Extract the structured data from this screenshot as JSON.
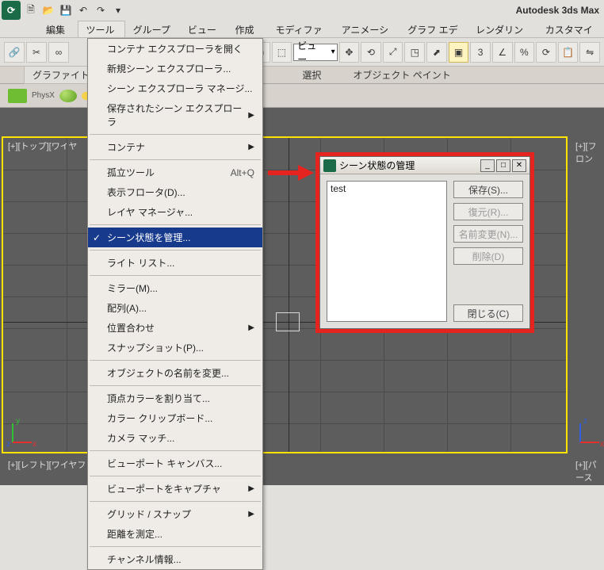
{
  "app": {
    "title": "Autodesk 3ds Max"
  },
  "menubar": {
    "items": [
      "編集(E)",
      "ツール(T)",
      "グループ(G)",
      "ビュー(V)",
      "作成(C)",
      "モディファイヤ",
      "アニメーション",
      "グラフ エディタ",
      "レンダリング(R)",
      "カスタマイズ(U"
    ],
    "active_index": 1
  },
  "toolbar2": {
    "combo_view_label": "ビュー",
    "super_label": "3"
  },
  "ribbon": {
    "tab1": "グラファイト モ",
    "tab_mid": "選択",
    "tab_right": "オブジェクト ペイント"
  },
  "physx": {
    "label": "PhysX"
  },
  "viewports": {
    "top_left": "[+][トップ][ワイヤ",
    "top_right": "[+][フロン",
    "bottom_left": "[+][レフト][ワイヤフレーム]",
    "bottom_right": "[+][パース"
  },
  "dropdown": {
    "items": [
      {
        "label": "コンテナ エクスプローラを開く"
      },
      {
        "label": "新規シーン エクスプローラ..."
      },
      {
        "label": "シーン エクスプローラ マネージ..."
      },
      {
        "label": "保存されたシーン エクスプローラ",
        "has_sub": true
      },
      {
        "sep": true
      },
      {
        "label": "コンテナ",
        "has_sub": true
      },
      {
        "sep": true
      },
      {
        "label": "孤立ツール",
        "shortcut": "Alt+Q"
      },
      {
        "label": "表示フロータ(D)..."
      },
      {
        "label": "レイヤ マネージャ..."
      },
      {
        "sep": true
      },
      {
        "label": "シーン状態を管理...",
        "checked": true,
        "highlight": true
      },
      {
        "sep": true
      },
      {
        "label": "ライト リスト..."
      },
      {
        "sep": true
      },
      {
        "label": "ミラー(M)..."
      },
      {
        "label": "配列(A)..."
      },
      {
        "label": "位置合わせ",
        "has_sub": true
      },
      {
        "label": "スナップショット(P)..."
      },
      {
        "sep": true
      },
      {
        "label": "オブジェクトの名前を変更..."
      },
      {
        "sep": true
      },
      {
        "label": "頂点カラーを割り当て..."
      },
      {
        "label": "カラー クリップボード..."
      },
      {
        "label": "カメラ マッチ..."
      },
      {
        "sep": true
      },
      {
        "label": "ビューポート キャンバス..."
      },
      {
        "sep": true
      },
      {
        "label": "ビューポートをキャプチャ",
        "has_sub": true
      },
      {
        "sep": true
      },
      {
        "label": "グリッド / スナップ",
        "has_sub": true
      },
      {
        "label": "距離を測定..."
      },
      {
        "sep": true
      },
      {
        "label": "チャンネル情報..."
      }
    ]
  },
  "dialog": {
    "title": "シーン状態の管理",
    "list_item": "test",
    "buttons": {
      "save": "保存(S)...",
      "restore": "復元(R)...",
      "rename": "名前変更(N)...",
      "delete": "削除(D)",
      "close": "閉じる(C)"
    }
  }
}
